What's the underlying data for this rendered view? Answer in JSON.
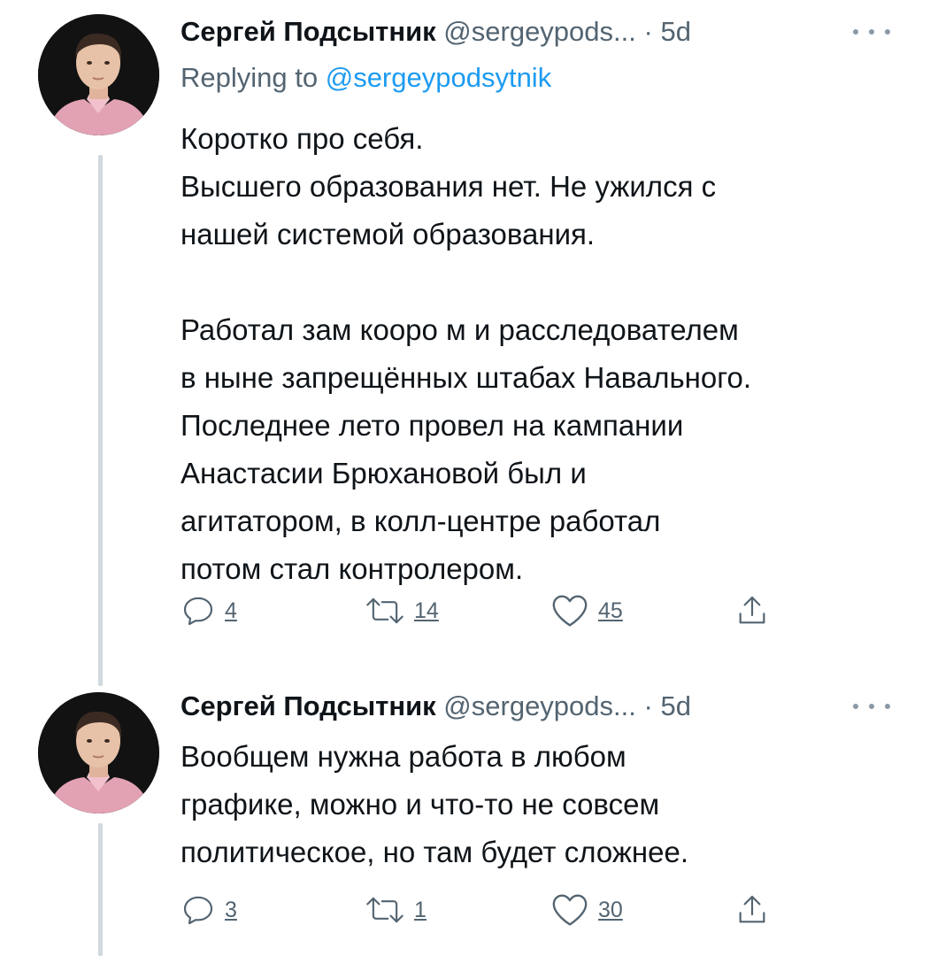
{
  "colors": {
    "text": "#0f1419",
    "secondary": "#536471",
    "link": "#1d9bf0",
    "thread_line": "#cfd9de"
  },
  "tweets": [
    {
      "author_name": "Сергей Подсытник",
      "handle": "@sergeypods...",
      "separator": "·",
      "time": "5d",
      "replying_to_label": "Replying to",
      "replying_to_handle": "@sergeypodsytnik",
      "paragraphs": [
        "Коротко про себя.\nВысшего образования нет. Не ужился с\nнашей системой образования.",
        "Работал зам кооро м и расследователем\nв ныне запрещённых штабах Навального.\nПоследнее лето провел на кампании\nАнастасии Брюхановой был и\nагитатором, в колл-центре работал\nпотом стал контролером."
      ],
      "replies": "4",
      "retweets": "14",
      "likes": "45"
    },
    {
      "author_name": "Сергей Подсытник",
      "handle": "@sergeypods...",
      "separator": "·",
      "time": "5d",
      "paragraphs": [
        "Вообщем нужна работа в любом\nграфике, можно и что-то не совсем\nполитическое, но там будет сложнее."
      ],
      "replies": "3",
      "retweets": "1",
      "likes": "30"
    }
  ],
  "icons": {
    "reply": "reply-icon",
    "retweet": "retweet-icon",
    "like": "heart-icon",
    "share": "share-icon",
    "more": "more-icon"
  }
}
